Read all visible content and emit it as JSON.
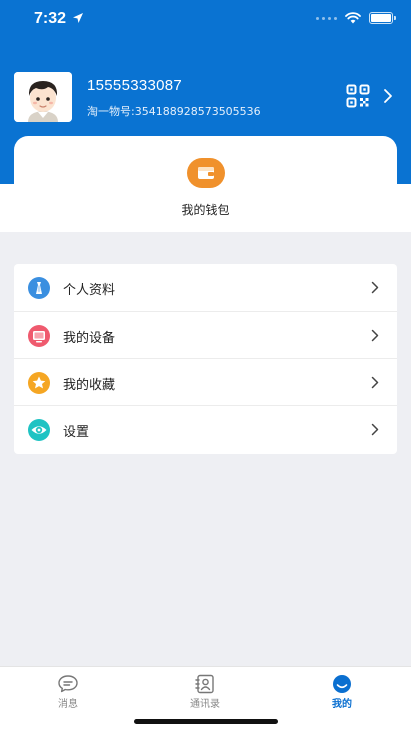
{
  "status_bar": {
    "time": "7:32",
    "icons": [
      "location-arrow-icon",
      "signal-dots-icon",
      "wifi-icon",
      "battery-icon"
    ]
  },
  "profile": {
    "phone": "15555333087",
    "subtitle": "淘一物号:354188928573505536",
    "avatar_icon": "cartoon-boy-avatar",
    "qr_icon": "qr-code-icon"
  },
  "wallet": {
    "label": "我的钱包",
    "icon": "wallet-icon",
    "color": "#f0912c"
  },
  "menu": {
    "items": [
      {
        "label": "个人资料",
        "icon": "profile-icon",
        "color": "#3a8fe0"
      },
      {
        "label": "我的设备",
        "icon": "device-icon",
        "color": "#ef5a6e"
      },
      {
        "label": "我的收藏",
        "icon": "star-icon",
        "color": "#f5a623"
      },
      {
        "label": "设置",
        "icon": "settings-eye-icon",
        "color": "#1fc3c3"
      }
    ]
  },
  "tabbar": {
    "tabs": [
      {
        "label": "消息",
        "icon": "chat-bubble-icon",
        "active": false
      },
      {
        "label": "通讯录",
        "icon": "contacts-book-icon",
        "active": false
      },
      {
        "label": "我的",
        "icon": "me-face-icon",
        "active": true
      }
    ]
  },
  "colors": {
    "header_blue": "#0a73d2",
    "background": "#eeeff3",
    "active_tab": "#0a6fd0"
  }
}
